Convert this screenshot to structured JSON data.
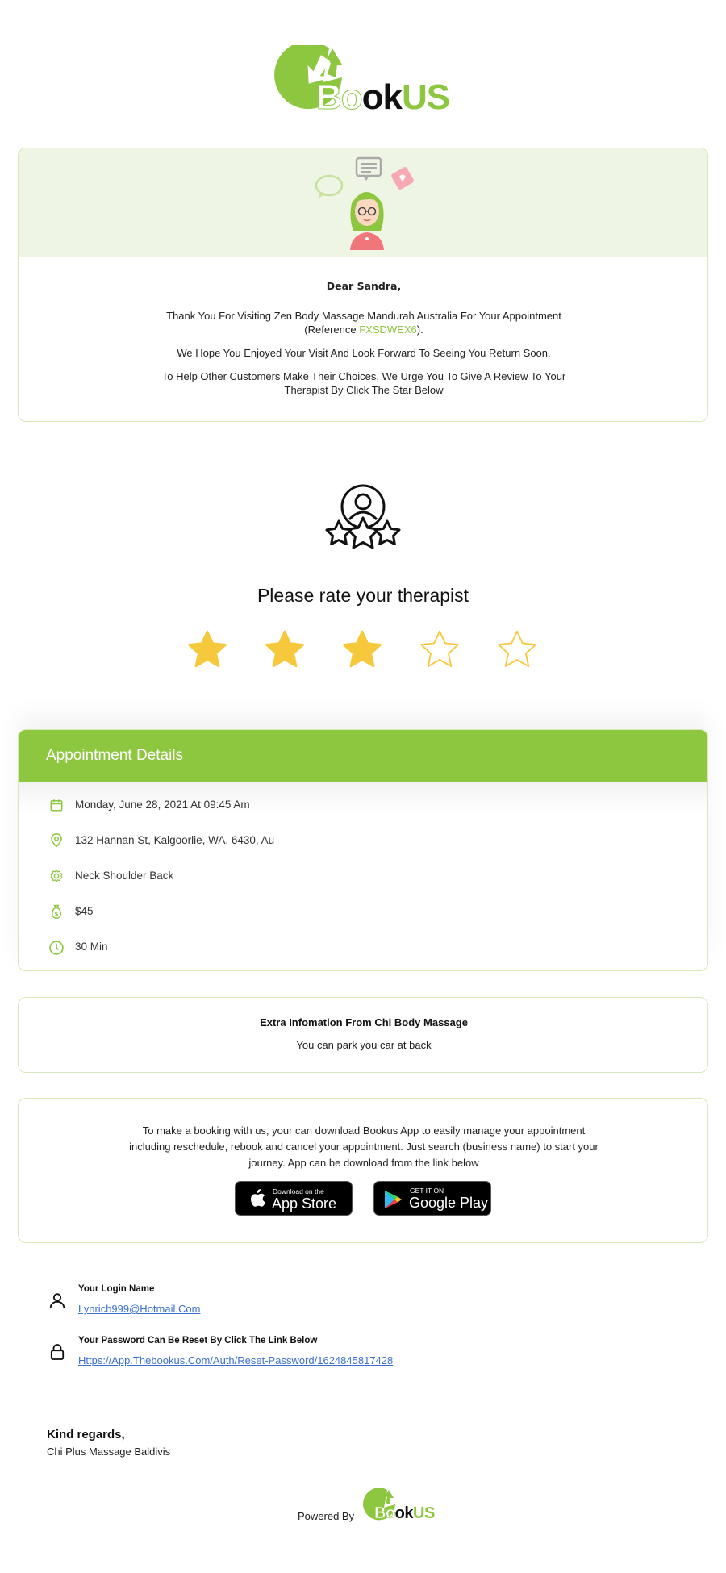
{
  "brand": {
    "logo_bo": "Bo",
    "logo_ok": "ok",
    "logo_us": "US",
    "accent": "#8dc63f"
  },
  "message": {
    "greeting": "Dear Sandra,",
    "line1a": "Thank You For Visiting Zen Body Massage Mandurah Australia For Your Appointment",
    "line1b_prefix": "(Reference ",
    "reference": "FXSDWEX6",
    "line1b_suffix": ").",
    "line2": "We Hope You Enjoyed Your Visit And Look Forward To Seeing You Return Soon.",
    "line3a": "To Help Other Customers Make Their Choices, We Urge You To Give A Review To Your",
    "line3b": "Therapist By Click The Star Below"
  },
  "rating": {
    "title": "Please rate your therapist",
    "value": 3,
    "max": 5,
    "star_color": "#f6c93c"
  },
  "appointment": {
    "header": "Appointment Details",
    "date": "Monday, June 28, 2021 At 09:45 Am",
    "address": "132 Hannan St, Kalgoorlie, WA, 6430, Au",
    "service": "Neck Shoulder Back",
    "price": "$45",
    "duration": "30 Min"
  },
  "extra_info": {
    "title": "Extra Infomation From Chi Body Massage",
    "text": "You can park you car at back"
  },
  "app_promo": {
    "line1": "To make a booking with us, your can download Bookus App to easily manage your appointment",
    "line2": "including reschedule, rebook and cancel your appointment. Just search (business name) to start your",
    "line3": "journey. App can be download from the link below",
    "appstore_small": "Download on the",
    "appstore_big": "App Store",
    "play_small": "GET IT ON",
    "play_big": "Google Play"
  },
  "login": {
    "label": "Your Login Name",
    "email": "Lynrich999@Hotmail.Com",
    "reset_label": "Your Password Can Be Reset By Click The Link Below",
    "reset_link": "Https://App.Thebookus.Com/Auth/Reset-Password/1624845817428"
  },
  "signoff": {
    "regards": "Kind regards,",
    "business": "Chi Plus Massage Baldivis"
  },
  "footer": {
    "powered_by": "Powered By"
  }
}
